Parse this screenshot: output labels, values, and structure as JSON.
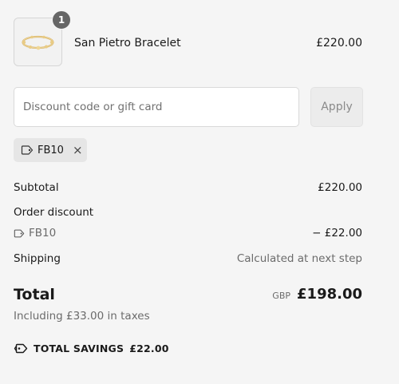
{
  "line_item": {
    "quantity": "1",
    "name": "San Pietro Bracelet",
    "price": "£220.00"
  },
  "discount": {
    "placeholder": "Discount code or gift card",
    "value": "",
    "apply_label": "Apply",
    "applied_code": "FB10",
    "remove_icon": "×"
  },
  "summary": {
    "subtotal_label": "Subtotal",
    "subtotal_value": "£220.00",
    "order_discount_label": "Order discount",
    "discount_code": "FB10",
    "discount_value": "− £22.00",
    "shipping_label": "Shipping",
    "shipping_value": "Calculated at next step",
    "total_label": "Total",
    "currency": "GBP",
    "total_value": "£198.00",
    "taxes_note": "Including £33.00 in taxes",
    "savings_label": "TOTAL SAVINGS",
    "savings_value": "£22.00"
  },
  "icons": {
    "product_image": "gold-bracelet",
    "tag": "tag-icon",
    "savings_tag": "tags-icon",
    "remove": "close-icon"
  }
}
